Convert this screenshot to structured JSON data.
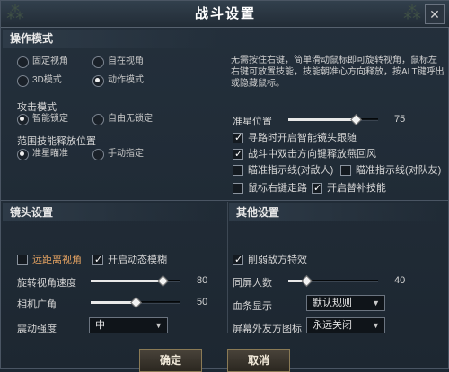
{
  "window": {
    "title": "战斗设置",
    "close_glyph": "✕"
  },
  "operation_mode": {
    "heading": "操作模式",
    "camera_options": [
      {
        "label": "固定视角",
        "selected": false
      },
      {
        "label": "自在视角",
        "selected": false
      },
      {
        "label": "3D模式",
        "selected": false
      },
      {
        "label": "动作模式",
        "selected": true
      }
    ],
    "description": "无需按住右键，简单滑动鼠标即可旋转视角，鼠标左右键可放置技能，技能朝准心方向释放，按ALT键呼出或隐藏鼠标。",
    "attack_heading": "攻击模式",
    "attack_options": [
      {
        "label": "智能锁定",
        "selected": true
      },
      {
        "label": "自由无锁定",
        "selected": false
      }
    ],
    "aoe_heading": "范围技能释放位置",
    "aoe_options": [
      {
        "label": "准星瞄准",
        "selected": true
      },
      {
        "label": "手动指定",
        "selected": false
      }
    ],
    "crosshair": {
      "label": "准星位置",
      "value": 75,
      "display": "75"
    },
    "checks": [
      {
        "label": "寻路时开启智能镜头跟随",
        "checked": true
      },
      {
        "label": "战斗中双击方向键释放燕回风",
        "checked": true
      },
      {
        "label": "瞄准指示线(对敌人)",
        "checked": false
      },
      {
        "label": "瞄准指示线(对队友)",
        "checked": false
      },
      {
        "label": "鼠标右键走路",
        "checked": false
      },
      {
        "label": "开启替补技能",
        "checked": true
      }
    ]
  },
  "camera": {
    "heading": "镜头设置",
    "far_view": {
      "label": "远距离视角",
      "checked": false
    },
    "motion_blur": {
      "label": "开启动态模糊",
      "checked": true
    },
    "rotate_speed": {
      "label": "旋转视角速度",
      "value": 80,
      "display": "80"
    },
    "fov": {
      "label": "相机广角",
      "value": 50,
      "display": "50"
    },
    "shake": {
      "label": "震动强度",
      "selected": "中"
    }
  },
  "other": {
    "heading": "其他设置",
    "weaken_enemy": {
      "label": "削弱敌方特效",
      "checked": true
    },
    "same_screen": {
      "label": "同屏人数",
      "value": 40,
      "display": "40"
    },
    "blood": {
      "label": "血条显示",
      "selected": "默认规则"
    },
    "offscreen_icon": {
      "label": "屏幕外友方图标",
      "selected": "永远关闭"
    }
  },
  "footer": {
    "confirm": "确定",
    "cancel": "取消"
  },
  "colors": {
    "accent_far_view": "#e0a060",
    "panel": "#1c2732"
  }
}
